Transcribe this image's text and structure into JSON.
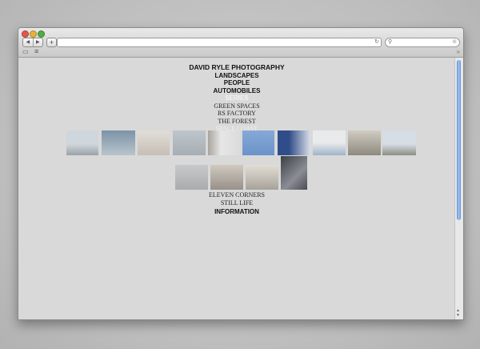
{
  "browser": {
    "back_label": "◀",
    "forward_label": "▶",
    "add_label": "+",
    "reload_icon": "↻",
    "search_icon": "🔍",
    "search_clear": "⊗",
    "bookmarks_icon": "book-icon",
    "list_icon": "list-icon",
    "overflow": "»"
  },
  "site": {
    "title": "DAVID RYLE PHOTOGRAPHY",
    "nav": [
      "LANDSCAPES",
      "PEOPLE",
      "AUTOMOBILES"
    ],
    "series_label": "SERIES",
    "series": [
      "GREEN SPACES",
      "RS FACTORY",
      "THE FOREST"
    ],
    "active_series": "SPACE COAST",
    "more_series": [
      "ELEVEN CORNERS",
      "STILL LIFE"
    ],
    "information": "INFORMATION"
  },
  "photos_row1": [
    {
      "name": "photo-beach-horizon",
      "c1": "#cfd6dc",
      "c2": "#9aa3a8"
    },
    {
      "name": "photo-sea-sky",
      "c1": "#7c93a6",
      "c2": "#b9c4cc"
    },
    {
      "name": "photo-hazy-shore",
      "c1": "#d9d5d0",
      "c2": "#c7bfb6"
    },
    {
      "name": "photo-grey-sea",
      "c1": "#b9c0c6",
      "c2": "#a6adb3"
    },
    {
      "name": "photo-white-building",
      "c1": "#dcdcdc",
      "c2": "#a8a39d"
    },
    {
      "name": "photo-blue-sky",
      "c1": "#86a9d6",
      "c2": "#6b93c9"
    },
    {
      "name": "photo-white-crowd",
      "c1": "#2f4d88",
      "c2": "#d9dfe6"
    },
    {
      "name": "photo-modern-building",
      "c1": "#e8eaec",
      "c2": "#9fb3c8"
    },
    {
      "name": "photo-street-palms",
      "c1": "#c9c3b8",
      "c2": "#8e8a80"
    },
    {
      "name": "photo-palm-trees",
      "c1": "#d6dde4",
      "c2": "#8c8f83"
    }
  ],
  "photos_row2": [
    {
      "name": "photo-foggy-spike",
      "c1": "#c7c9cb",
      "c2": "#a9abad"
    },
    {
      "name": "photo-sand-beach",
      "c1": "#c8c1b6",
      "c2": "#97918a"
    },
    {
      "name": "photo-umbrella",
      "c1": "#dcd7cd",
      "c2": "#a7a19a"
    },
    {
      "name": "photo-dark-clouds",
      "c1": "#3b3f45",
      "c2": "#8a8e94"
    }
  ]
}
